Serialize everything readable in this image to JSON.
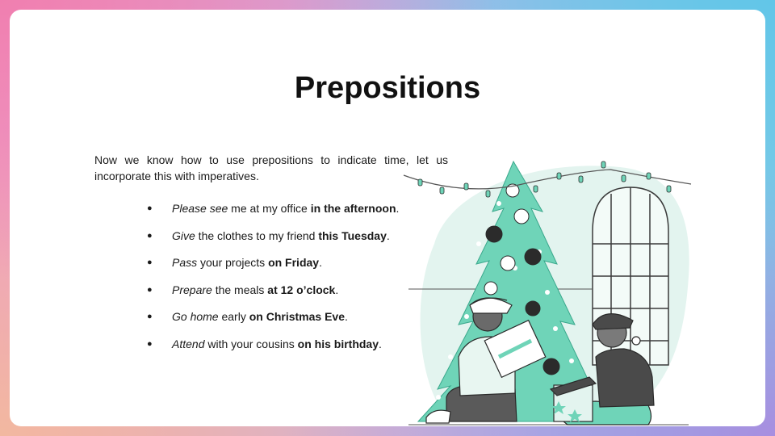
{
  "slide": {
    "title": "Prepositions",
    "intro": "Now we know how to use prepositions to indicate time, let us incorporate this with imperatives.",
    "bullet_glyph": "●",
    "items": [
      {
        "verb": "Please see",
        "middle": " me at my office ",
        "time": "in the afternoon",
        "end": "."
      },
      {
        "verb": "Give",
        "middle": " the clothes to my friend ",
        "time": "this Tuesday",
        "end": "."
      },
      {
        "verb": "Pass",
        "middle": " your projects ",
        "time": "on Friday",
        "end": "."
      },
      {
        "verb": "Prepare",
        "middle": " the meals ",
        "time": "at 12 o’clock",
        "end": "."
      },
      {
        "verb": "Go home",
        "middle": " early ",
        "time": "on Christmas Eve",
        "end": "."
      },
      {
        "verb": "Attend",
        "middle": " with your cousins ",
        "time": "on his birthday",
        "end": "."
      }
    ]
  },
  "colors": {
    "accent_teal": "#6fd4b8",
    "light_teal": "#e3f4ef",
    "dark": "#2b2b2b"
  }
}
